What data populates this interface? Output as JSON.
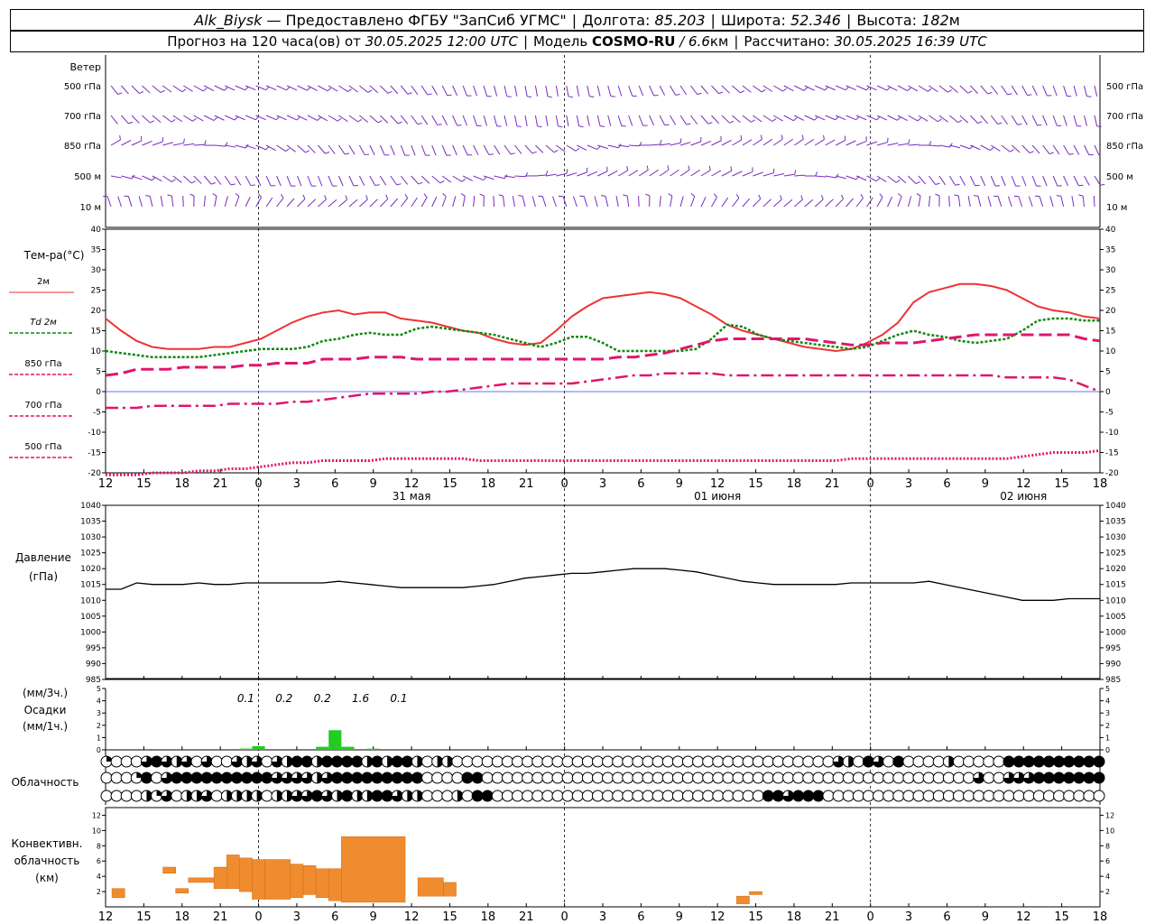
{
  "header": {
    "station": "Alk_Biysk",
    "provider": "— Предоставлено ФГБУ \"ЗапСиб УГМС\"",
    "lon_label": "Долгота:",
    "lon_value": "85.203",
    "lat_label": "Широта:",
    "lat_value": "52.346",
    "alt_label": "Высота:",
    "alt_value": "182",
    "alt_unit": "м",
    "forecast_prefix": "Прогноз на 120 часа(ов) от",
    "forecast_start": "30.05.2025 12:00 UTC",
    "model_label": "Модель",
    "model_name": "COSMO-RU",
    "model_res": "/ 6.6",
    "model_res_unit": "км",
    "calc_label": "Рассчитано:",
    "calc_time": "30.05.2025 16:39 UTC"
  },
  "colors": {
    "t2m": "#ee3333",
    "td2m": "#118811",
    "t850": "#e0156e",
    "t700": "#e0156e",
    "t500": "#e0156e",
    "pressure": "#000000",
    "precip": "#22cc22",
    "conv": "#f08c30",
    "wind": "#7a2bbf"
  },
  "time_axis": {
    "hours": [
      "12",
      "15",
      "18",
      "21",
      "0",
      "3",
      "6",
      "9",
      "12",
      "15",
      "18",
      "21",
      "0",
      "3",
      "6",
      "9",
      "12",
      "15",
      "18",
      "21",
      "0",
      "3",
      "6",
      "9",
      "12",
      "15",
      "18"
    ],
    "day_labels": [
      {
        "text": "31 мая",
        "at_index": 8
      },
      {
        "text": "01 июня",
        "at_index": 16
      },
      {
        "text": "02 июня",
        "at_index": 24
      }
    ]
  },
  "wind_panel": {
    "title": "Ветер",
    "levels": [
      "500 гПа",
      "700 гПа",
      "850 гПа",
      "500 м",
      "10  м"
    ]
  },
  "chart_data": [
    {
      "type": "line",
      "name": "temperature",
      "ylabel": "Тем-ра(°C)",
      "ylim": [
        -20,
        40
      ],
      "yticks": [
        -20,
        -15,
        -10,
        -5,
        0,
        5,
        10,
        15,
        20,
        25,
        30,
        35,
        40
      ],
      "x_hours": [
        0,
        3,
        6,
        9,
        12,
        15,
        18,
        21,
        24,
        27,
        30,
        33,
        36,
        39,
        42,
        45,
        48,
        51,
        54,
        57,
        60,
        63,
        66,
        69,
        72,
        75,
        78,
        81,
        84,
        87,
        90,
        93,
        96,
        99,
        102,
        105,
        108,
        111,
        114,
        117,
        120,
        123,
        126,
        129,
        132,
        135,
        138,
        141,
        144,
        147,
        150,
        153,
        156,
        159,
        162,
        165,
        168,
        171,
        174,
        177,
        180,
        183,
        186,
        189,
        192,
        195,
        198,
        201,
        204,
        207,
        210,
        213,
        216,
        219,
        222,
        225,
        228,
        231,
        234
      ],
      "series": [
        {
          "name": "2м",
          "style": "solid",
          "values": [
            18,
            15,
            12.5,
            11,
            10.5,
            10.5,
            10.5,
            11,
            11,
            12,
            13,
            15,
            17,
            18.5,
            19.5,
            20,
            19,
            19.5,
            19.5,
            18,
            17.5,
            17,
            16,
            15,
            14.5,
            13,
            12,
            11.5,
            12,
            15,
            18.5,
            21,
            23,
            23.5,
            24,
            24.5,
            24,
            23,
            21,
            19,
            16.5,
            15,
            14,
            13,
            12,
            11,
            10.5,
            10,
            10.5,
            12,
            14,
            17,
            22,
            24.5,
            25.5,
            26.5,
            26.5,
            26,
            25,
            23,
            21,
            20,
            19.5,
            18.5,
            18
          ]
        },
        {
          "name": "Td 2м",
          "style": "dotted",
          "values": [
            10,
            9.5,
            9,
            8.5,
            8.5,
            8.5,
            8.5,
            9,
            9.5,
            10,
            10.5,
            10.5,
            10.5,
            11,
            12.5,
            13,
            14,
            14.5,
            14,
            14,
            15.5,
            16,
            15.5,
            15,
            14.5,
            14,
            13,
            12,
            11,
            12,
            13.5,
            13.5,
            12,
            10,
            10,
            10,
            10,
            10,
            10.5,
            13,
            16.5,
            16,
            14,
            13,
            12.5,
            12,
            11.5,
            11,
            10.5,
            11,
            12.5,
            14,
            15,
            14,
            13.5,
            12.5,
            12,
            12.5,
            13,
            15,
            17.5,
            18,
            18,
            17.5,
            17.5
          ]
        },
        {
          "name": "850 гПа",
          "style": "dashed",
          "values": [
            4,
            4.5,
            5.5,
            5.5,
            5.5,
            6,
            6,
            6,
            6,
            6.5,
            6.5,
            7,
            7,
            7,
            8,
            8,
            8,
            8.5,
            8.5,
            8.5,
            8,
            8,
            8,
            8,
            8,
            8,
            8,
            8,
            8,
            8,
            8,
            8,
            8,
            8.5,
            8.5,
            9,
            9.5,
            10.5,
            11.5,
            12.5,
            13,
            13,
            13,
            13,
            13,
            13,
            12.5,
            12,
            11.5,
            11.5,
            12,
            12,
            12,
            12.5,
            13,
            13.5,
            14,
            14,
            14,
            14,
            14,
            14,
            14,
            13,
            12.5
          ]
        },
        {
          "name": "700 гПа",
          "style": "dashdot",
          "values": [
            -4,
            -4,
            -4,
            -3.5,
            -3.5,
            -3.5,
            -3.5,
            -3.5,
            -3,
            -3,
            -3,
            -3,
            -2.5,
            -2.5,
            -2,
            -1.5,
            -1,
            -0.5,
            -0.5,
            -0.5,
            -0.5,
            0,
            0,
            0.5,
            1,
            1.5,
            2,
            2,
            2,
            2,
            2,
            2.5,
            3,
            3.5,
            4,
            4,
            4.5,
            4.5,
            4.5,
            4.5,
            4,
            4,
            4,
            4,
            4,
            4,
            4,
            4,
            4,
            4,
            4,
            4,
            4,
            4,
            4,
            4,
            4,
            4,
            3.5,
            3.5,
            3.5,
            3.5,
            3,
            1.5,
            0
          ]
        },
        {
          "name": "500 гПа",
          "style": "densedot",
          "values": [
            -20.5,
            -20.5,
            -20.5,
            -20,
            -20,
            -20,
            -19.5,
            -19.5,
            -19,
            -19,
            -18.5,
            -18,
            -17.5,
            -17.5,
            -17,
            -17,
            -17,
            -17,
            -16.5,
            -16.5,
            -16.5,
            -16.5,
            -16.5,
            -16.5,
            -17,
            -17,
            -17,
            -17,
            -17,
            -17,
            -17,
            -17,
            -17,
            -17,
            -17,
            -17,
            -17,
            -17,
            -17,
            -17,
            -17,
            -17,
            -17,
            -17,
            -17,
            -17,
            -17,
            -17,
            -16.5,
            -16.5,
            -16.5,
            -16.5,
            -16.5,
            -16.5,
            -16.5,
            -16.5,
            -16.5,
            -16.5,
            -16.5,
            -16,
            -15.5,
            -15,
            -15,
            -15,
            -14.5
          ]
        }
      ]
    },
    {
      "type": "line",
      "name": "pressure",
      "ylabel": "Давление",
      "yunit": "(гПа)",
      "ylim": [
        985,
        1040
      ],
      "yticks": [
        985,
        990,
        995,
        1000,
        1005,
        1010,
        1015,
        1020,
        1025,
        1030,
        1035,
        1040
      ],
      "series": [
        {
          "name": "Давление",
          "values": [
            1013.5,
            1013.5,
            1015.5,
            1015,
            1015,
            1015,
            1015.5,
            1015,
            1015,
            1015.5,
            1015.5,
            1015.5,
            1015.5,
            1015.5,
            1015.5,
            1016,
            1015.5,
            1015,
            1014.5,
            1014,
            1014,
            1014,
            1014,
            1014,
            1014.5,
            1015,
            1016,
            1017,
            1017.5,
            1018,
            1018.5,
            1018.5,
            1019,
            1019.5,
            1020,
            1020,
            1020,
            1019.5,
            1019,
            1018,
            1017,
            1016,
            1015.5,
            1015,
            1015,
            1015,
            1015,
            1015,
            1015.5,
            1015.5,
            1015.5,
            1015.5,
            1015.5,
            1016,
            1015,
            1014,
            1013,
            1012,
            1011,
            1010,
            1010,
            1010,
            1010.5,
            1010.5,
            1010.5
          ]
        }
      ]
    },
    {
      "type": "bar",
      "name": "precipitation",
      "ylabel": "Осадки",
      "yunit_top": "(мм/3ч.)",
      "yunit_bottom": "(мм/1ч.)",
      "ylim": [
        0,
        5
      ],
      "yticks": [
        0,
        1,
        2,
        3,
        4,
        5
      ],
      "labels": [
        {
          "hour": -1,
          "text": "0.1"
        },
        {
          "hour": 2,
          "text": "0.2"
        },
        {
          "hour": 5,
          "text": "0.2"
        },
        {
          "hour": 8,
          "text": "1.6"
        },
        {
          "hour": 11,
          "text": "0.1"
        }
      ],
      "bars": [
        {
          "hour": -1,
          "value": 0.1
        },
        {
          "hour": 0,
          "value": 0.3
        },
        {
          "hour": 5,
          "value": 0.25
        },
        {
          "hour": 6,
          "value": 1.6
        },
        {
          "hour": 7,
          "value": 0.25
        },
        {
          "hour": 9,
          "value": 0.1
        }
      ]
    },
    {
      "type": "bar",
      "name": "convective-cloud",
      "ylabel": "Конвективн.",
      "ylabel2": "облачность",
      "yunit": "(км)",
      "ylim": [
        0,
        13
      ],
      "yticks": [
        2,
        4,
        6,
        8,
        10,
        12
      ],
      "bars": [
        {
          "start": -11.5,
          "end": -10.5,
          "bottom": 1.2,
          "top": 2.4
        },
        {
          "start": -7.5,
          "end": -6.5,
          "bottom": 4.4,
          "top": 5.2
        },
        {
          "start": -6.5,
          "end": -5.5,
          "bottom": 1.8,
          "top": 2.4
        },
        {
          "start": -5.5,
          "end": -3.5,
          "bottom": 3.2,
          "top": 3.8
        },
        {
          "start": -3.5,
          "end": -2.5,
          "bottom": 2.4,
          "top": 5.2
        },
        {
          "start": -2.5,
          "end": -1.5,
          "bottom": 2.4,
          "top": 6.8
        },
        {
          "start": -1.5,
          "end": -0.5,
          "bottom": 2.0,
          "top": 6.4
        },
        {
          "start": -0.5,
          "end": 0.5,
          "bottom": 1.0,
          "top": 6.2
        },
        {
          "start": 0.5,
          "end": 2.5,
          "bottom": 1.0,
          "top": 6.2
        },
        {
          "start": 2.5,
          "end": 3.5,
          "bottom": 1.2,
          "top": 5.6
        },
        {
          "start": 3.5,
          "end": 4.5,
          "bottom": 1.6,
          "top": 5.4
        },
        {
          "start": 4.5,
          "end": 5.5,
          "bottom": 1.2,
          "top": 5.0
        },
        {
          "start": 5.5,
          "end": 6.5,
          "bottom": 0.8,
          "top": 5.0
        },
        {
          "start": 6.5,
          "end": 11.5,
          "bottom": 0.6,
          "top": 9.2
        },
        {
          "start": 12.5,
          "end": 14.5,
          "bottom": 1.4,
          "top": 3.8
        },
        {
          "start": 14.5,
          "end": 15.5,
          "bottom": 1.4,
          "top": 3.2
        },
        {
          "start": 37.5,
          "end": 38.5,
          "bottom": 0.4,
          "top": 1.4
        },
        {
          "start": 38.5,
          "end": 39.5,
          "bottom": 1.6,
          "top": 2.0
        }
      ]
    }
  ],
  "cloud_panel": {
    "title": "Облачность",
    "rows": [
      [
        1,
        0,
        0,
        0,
        3,
        4,
        3,
        2,
        3,
        0,
        3,
        0,
        0,
        3,
        2,
        3,
        0,
        3,
        2,
        4,
        4,
        2,
        4,
        4,
        4,
        4,
        2,
        4,
        2,
        4,
        4,
        2,
        0,
        2,
        2,
        0,
        0,
        0,
        0,
        0,
        0,
        0,
        0,
        0,
        0,
        0,
        0,
        0,
        0,
        0,
        0,
        0,
        0,
        0,
        0,
        0,
        0,
        0,
        0,
        0,
        0,
        0,
        0,
        0,
        0,
        0,
        0,
        0,
        0,
        0,
        0,
        0,
        0,
        3,
        2,
        0,
        4,
        3,
        0,
        4,
        0,
        0,
        0,
        0,
        2,
        0,
        0,
        0,
        0,
        0,
        4,
        4,
        4,
        4,
        4,
        4,
        4,
        4,
        4,
        4
      ],
      [
        0,
        0,
        0,
        1,
        4,
        0,
        3,
        4,
        4,
        4,
        4,
        4,
        4,
        4,
        4,
        4,
        4,
        3,
        3,
        3,
        3,
        2,
        3,
        4,
        4,
        4,
        4,
        4,
        4,
        4,
        4,
        4,
        0,
        0,
        0,
        0,
        4,
        4,
        0,
        0,
        0,
        0,
        0,
        0,
        0,
        0,
        0,
        0,
        0,
        0,
        0,
        0,
        0,
        0,
        0,
        0,
        0,
        0,
        0,
        0,
        0,
        0,
        0,
        0,
        0,
        0,
        0,
        0,
        0,
        0,
        0,
        0,
        0,
        0,
        0,
        0,
        0,
        0,
        0,
        0,
        0,
        0,
        0,
        0,
        0,
        0,
        0,
        3,
        0,
        0,
        3,
        3,
        3,
        4,
        4,
        4,
        4,
        4,
        4,
        4
      ],
      [
        0,
        0,
        0,
        0,
        2,
        1,
        3,
        0,
        2,
        2,
        3,
        0,
        2,
        2,
        2,
        2,
        0,
        2,
        2,
        3,
        3,
        4,
        3,
        2,
        4,
        2,
        2,
        4,
        4,
        3,
        2,
        2,
        0,
        0,
        0,
        2,
        0,
        4,
        4,
        0,
        0,
        0,
        0,
        0,
        0,
        0,
        0,
        0,
        0,
        0,
        0,
        0,
        0,
        0,
        0,
        0,
        0,
        0,
        0,
        0,
        0,
        0,
        0,
        0,
        0,
        0,
        4,
        4,
        3,
        4,
        4,
        4,
        0,
        0,
        0,
        0,
        0,
        0,
        0,
        0,
        0,
        0,
        0,
        0,
        0,
        0,
        0,
        0,
        0,
        0,
        0,
        0,
        0,
        0,
        0,
        0,
        0,
        0,
        0,
        0
      ]
    ]
  }
}
